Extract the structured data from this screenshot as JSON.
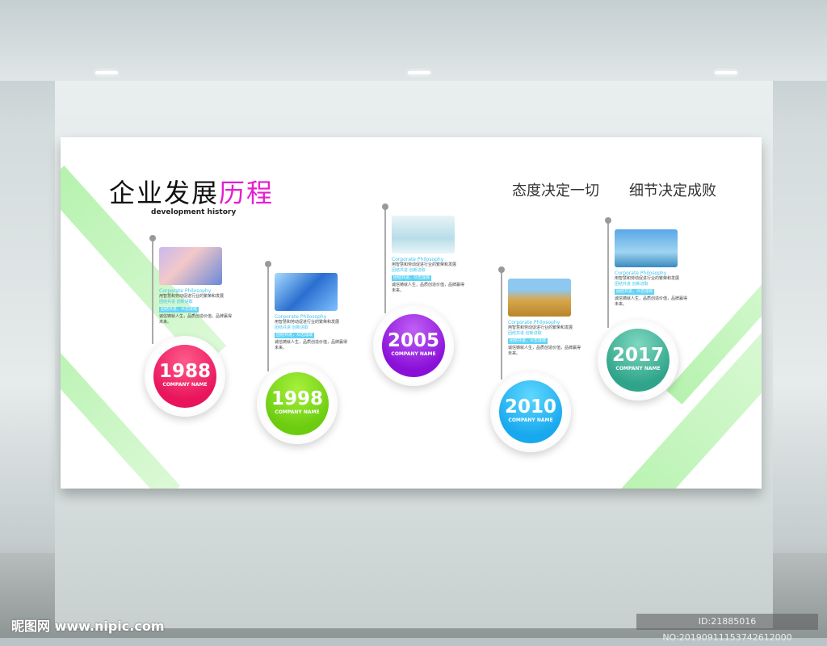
{
  "title": {
    "main": "企业发展",
    "highlight": "历程",
    "subtitle": "development history"
  },
  "slogans": [
    "态度决定一切",
    "细节决定成败"
  ],
  "milestones": [
    {
      "year": "1988",
      "company": "COMPANY NAME",
      "color": "#e8145c",
      "color2": "#ff5a8a",
      "heading": "Corporate Philosophy",
      "line1": "用智慧和劳动促进行业的繁荣和发展",
      "line2": "团结共进 创新进取",
      "tag": "团结共进，众志成城",
      "line3": "诚信铸就人生，品质创造价值，品牌赢得未来。",
      "image": "handshake-city"
    },
    {
      "year": "1998",
      "company": "COMPANY NAME",
      "color": "#6ccc10",
      "color2": "#a6f03c",
      "heading": "Corporate Philosophy",
      "line1": "用智慧和劳动促进行业的繁荣和发展",
      "line2": "团结共进 创新进取",
      "tag": "团结共进，众志成城",
      "line3": "诚信铸就人生，品质创造价值，品牌赢得未来。",
      "image": "skyscraper"
    },
    {
      "year": "2005",
      "company": "COMPANY NAME",
      "color": "#8a10d8",
      "color2": "#c060f5",
      "heading": "Corporate Philosophy",
      "line1": "用智慧和劳动促进行业的繁荣和发展",
      "line2": "团结共进 创新进取",
      "tag": "团结共进，众志成城",
      "line3": "诚信铸就人生，品质创造价值，品牌赢得未来。",
      "image": "businessman-clouds"
    },
    {
      "year": "2010",
      "company": "COMPANY NAME",
      "color": "#18a8ee",
      "color2": "#5fd8ff",
      "heading": "Corporate Philosophy",
      "line1": "用智慧和劳动促进行业的繁荣和发展",
      "line2": "团结共进 创新进取",
      "tag": "团结共进，众志成城",
      "line3": "诚信铸就人生，品质创造价值，品牌赢得未来。",
      "image": "wheat"
    },
    {
      "year": "2017",
      "company": "COMPANY NAME",
      "color": "#2fa48a",
      "color2": "#7fd8c0",
      "heading": "Corporate Philosophy",
      "line1": "用智慧和劳动促进行业的繁荣和发展",
      "line2": "团结共进 创新进取",
      "tag": "团结共进，众志成城",
      "line3": "诚信铸就人生，品质创造价值，品牌赢得未来。",
      "image": "city-towers"
    }
  ],
  "watermark": "昵图网 www.nipic.com",
  "image_id": "ID:21885016 NO:20190911153742612000"
}
